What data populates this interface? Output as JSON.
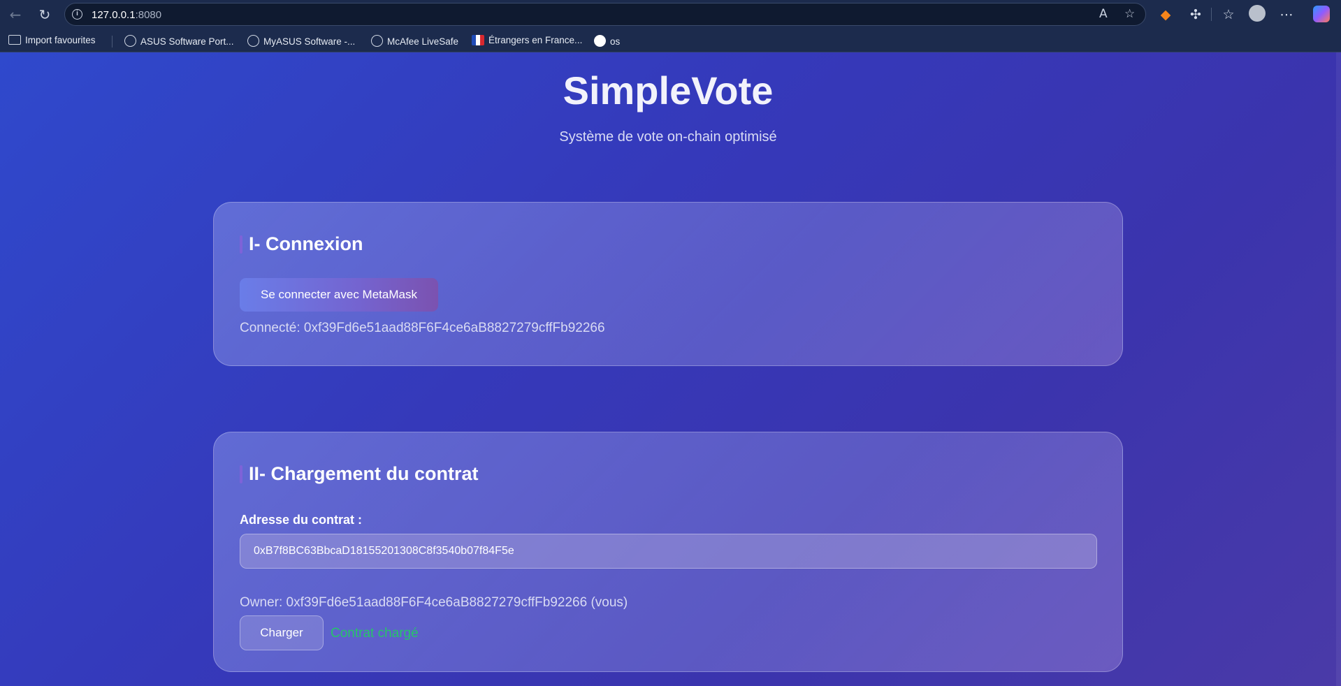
{
  "browser": {
    "url_host": "127.0.0.1",
    "url_port": ":8080",
    "favourites": [
      {
        "label": "Import favourites",
        "icon": "folder-import-icon"
      },
      {
        "label": "ASUS Software Port...",
        "icon": "globe-icon"
      },
      {
        "label": "MyASUS Software -...",
        "icon": "globe-icon"
      },
      {
        "label": "McAfee LiveSafe",
        "icon": "globe-icon"
      },
      {
        "label": "Étrangers en France...",
        "icon": "french-flag-icon"
      },
      {
        "label": "os",
        "icon": "github-icon"
      }
    ]
  },
  "header": {
    "title": "SimpleVote",
    "subtitle": "Système de vote on-chain optimisé"
  },
  "connexion": {
    "title": "I- Connexion",
    "button_label": "Se connecter avec MetaMask",
    "connected_text": "Connecté: 0xf39Fd6e51aad88F6F4ce6aB8827279cffFb92266"
  },
  "contrat": {
    "title": "II- Chargement du contrat",
    "address_label": "Adresse du contrat :",
    "address_value": "0xB7f8BC63BbcaD18155201308C8f3540b07f84F5e",
    "owner_text": "Owner: 0xf39Fd6e51aad88F6F4ce6aB8827279cffFb92266 (vous)",
    "load_button_label": "Charger",
    "status_text": "Contrat chargé",
    "status_color": "#27c46a"
  }
}
